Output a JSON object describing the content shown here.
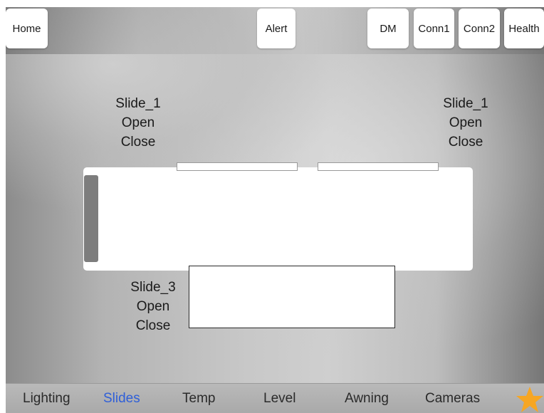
{
  "header": {
    "buttons": {
      "home": "Home",
      "alert": "Alert",
      "dm": "DM",
      "conn1": "Conn1",
      "conn2": "Conn2",
      "health": "Health"
    }
  },
  "slides": {
    "left": {
      "name": "Slide_1",
      "open": "Open",
      "close": "Close"
    },
    "right": {
      "name": "Slide_1",
      "open": "Open",
      "close": "Close"
    },
    "bottom": {
      "name": "Slide_3",
      "open": "Open",
      "close": "Close"
    }
  },
  "nav": {
    "items": [
      "Lighting",
      "Slides",
      "Temp",
      "Level",
      "Awning",
      "Cameras"
    ],
    "active": "Slides",
    "star_icon": "star-icon"
  },
  "colors": {
    "active_nav": "#2f5fd8",
    "star": "#f6a623",
    "handle": "#7d7d7d"
  }
}
